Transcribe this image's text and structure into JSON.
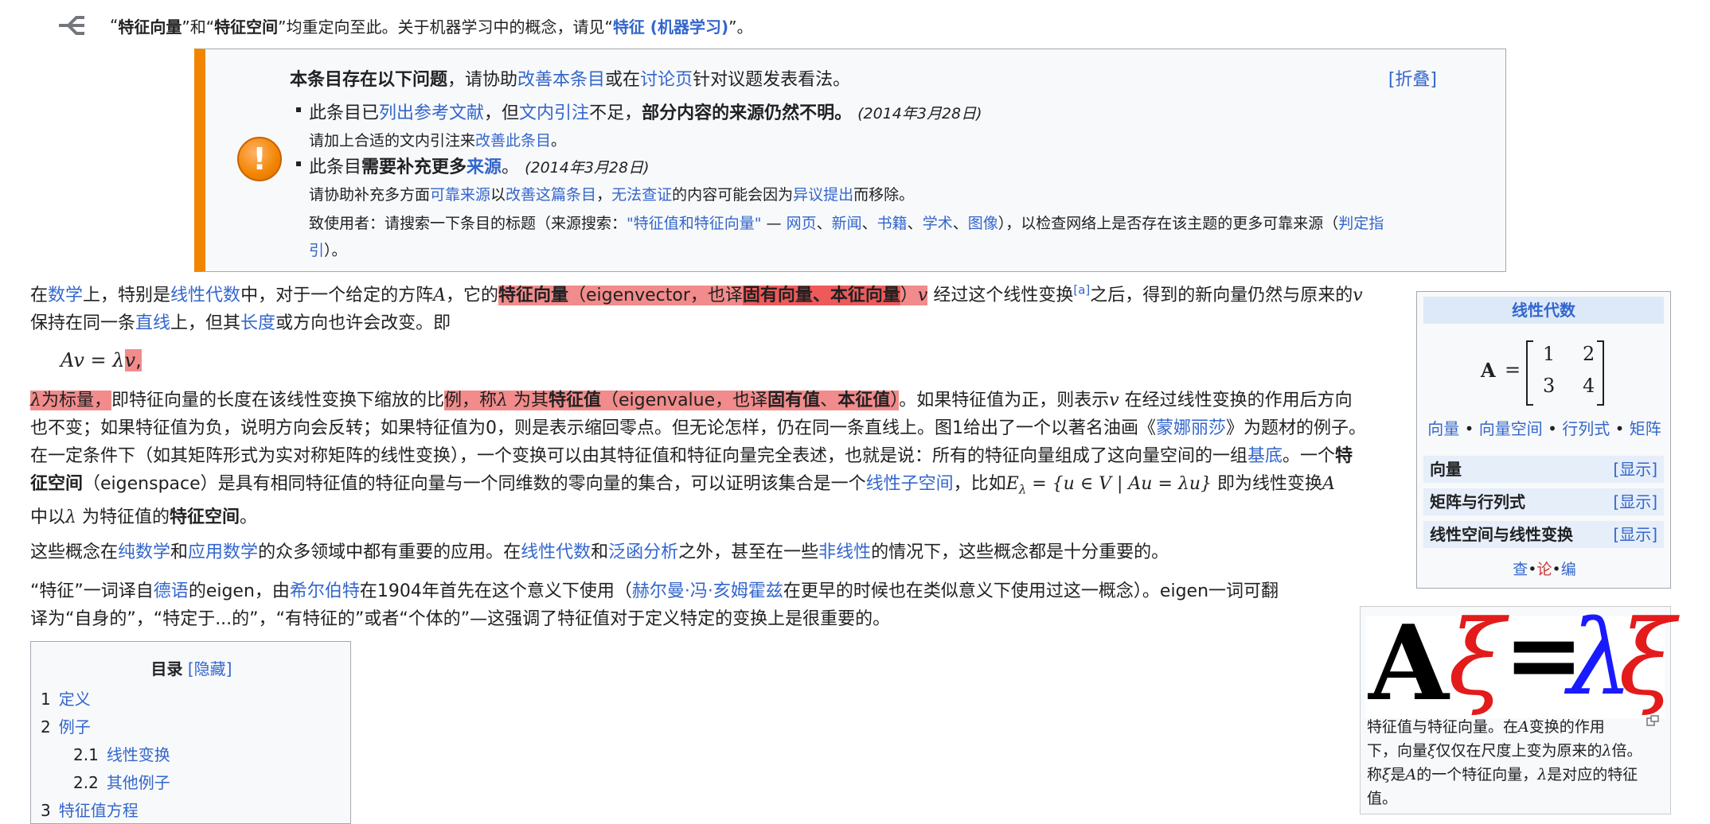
{
  "hatnote": {
    "icon": "disambiguation-icon",
    "q1": "“",
    "term1": "特征向量",
    "q2": "”和“",
    "term2": "特征空间",
    "text": "”均重定向至此。关于机器学习中的概念，请见“",
    "link": "特征 (机器学习)",
    "end": "”。"
  },
  "issues": {
    "title_bold": "本条目存在以下问题",
    "title_mid1": "，请协助",
    "title_link1": "改善本条目",
    "title_mid2": "或在",
    "title_link2": "讨论页",
    "title_end": "针对议题发表看法。",
    "fold": "[折叠]",
    "item1_a": "此条目已",
    "item1_link1": "列出参考文献",
    "item1_b": "，但",
    "item1_link2": "文内引注",
    "item1_c": "不足，",
    "item1_bold": "部分内容的来源仍然不明。",
    "item1_date": "(2014年3月28日)",
    "item1_sub_a": "请加上合适的文内引注来",
    "item1_sub_link": "改善此条目",
    "item1_sub_b": "。",
    "item2_a": "此条目",
    "item2_bold": "需要补充更多",
    "item2_link": "来源",
    "item2_b": "。",
    "item2_date": "(2014年3月28日)",
    "item2_sub1_a": "请协助补充多方面",
    "item2_sub1_link1": "可靠来源",
    "item2_sub1_b": "以",
    "item2_sub1_link2": "改善这篇条目",
    "item2_sub1_c": "，",
    "item2_sub1_link3": "无法查证",
    "item2_sub1_d": "的内容可能会因为",
    "item2_sub1_link4": "异议提出",
    "item2_sub1_e": "而移除。",
    "item2_sub2_a": "致使用者：请搜索一下条目的标题（来源搜索：",
    "item2_sub2_link1": "\"特征值和特征向量\"",
    "item2_sub2_b": " — ",
    "item2_sub2_link2": "网页",
    "item2_sub2_s1": "、",
    "item2_sub2_link3": "新闻",
    "item2_sub2_s2": "、",
    "item2_sub2_link4": "书籍",
    "item2_sub2_s3": "、",
    "item2_sub2_link5": "学术",
    "item2_sub2_s4": "、",
    "item2_sub2_link6": "图像",
    "item2_sub2_c": "），以检查网络上是否存在该主题的更多可靠来源（",
    "item2_sub2_link7a": "判定指",
    "item2_sub2_link7b": "引",
    "item2_sub2_d": "）。"
  },
  "para1": {
    "t1": "在",
    "l1": "数学",
    "t2": "上，特别是",
    "l2": "线性代数",
    "t3": "中，对于一个给定的方阵",
    "m1": "A",
    "t4": "，它的",
    "b1": "特征向量",
    "t5": "（eigenvector，也译",
    "b2": "固有向量、本征向量",
    "t6": "）",
    "m2": "v",
    "t7": " 经过这个线性变换",
    "ref": "[a]",
    "t8": "之后，得到的新向量仍然与原来的",
    "m3": "v",
    "l2a": "保持在同一条",
    "l3": "直线",
    "t9": "上，但其",
    "l4": "长度",
    "t10": "或方向也许会改变。即"
  },
  "eq1": {
    "lhs": "Av",
    "eq": " = ",
    "lam": "λ",
    "v": "v",
    "comma": ","
  },
  "para2": {
    "lam": "λ",
    "t1": "为标量，",
    "t2": "即特征向量的长度在该线性变换下缩放的比",
    "t3": "例，称",
    "lam2": "λ",
    "t4": " 为其",
    "b1": "特征值",
    "t5": "（eigenvalue，也译",
    "b2": "固有值",
    "t6": "、",
    "b3": "本征值",
    "t7": "）",
    "t8": "。如果特征值为正，则表示",
    "mv": "v",
    "t9": " 在经过线性变换的作用后方向",
    "line2": "也不变；如果特征值为负，说明方向会反转；如果特征值为0，则是表示缩回零点。但无论怎样，仍在同一条直线上。图1给出了一个以著名油画《",
    "l1": "蒙娜丽莎",
    "line2b": "》为题材的例子。",
    "line3": "在一定条件下（如其矩阵形式为实对称矩阵的线性变换），一个变换可以由其特征值和特征向量完全表述，也就是说：所有的特征向量组成了这向量空间的一组",
    "l2": "基底",
    "line3b": "。一个",
    "b4": "特",
    "b5": "征空间",
    "line4": "（eigenspace）是具有相同特征值的特征向量与一个同维数的零向量的集合，可以证明该集合是一个",
    "l3": "线性子空间",
    "line4b": "，比如",
    "eq": "E",
    "eqsub": "λ",
    "eqrest": " = {u ∈ V | Au = λu}",
    "line4c": " 即为线性变换",
    "mA": "A",
    "line5": "中以",
    "lam3": "λ",
    "line5b": " 为特征值的",
    "b6": "特征空间",
    "line5c": "。"
  },
  "para3": {
    "t1": "这些概念在",
    "l1": "纯数学",
    "t2": "和",
    "l2": "应用数学",
    "t3": "的众多领域中都有重要的应用。在",
    "l3": "线性代数",
    "t4": "和",
    "l4": "泛函分析",
    "t5": "之外，甚至在一些",
    "l5": "非线性",
    "t6": "的情况下，这些概念都是十分重要的。"
  },
  "para4": {
    "t1": "“特征”一词译自",
    "l1": "德语",
    "t2": "的eigen，由",
    "l2": "希尔伯特",
    "t3": "在1904年首先在这个意义下使用（",
    "l3": "赫尔曼·冯·亥姆霍兹",
    "t4": "在更早的时候也在类似意义下使用过这一概念）。eigen一词可翻",
    "line2": "译为“自身的”，“特定于...的”，“有特征的”或者“个体的”—这强调了特征值对于定义特定的变换上是很重要的。"
  },
  "navbox": {
    "title": "线性代数",
    "matrix_label": "A",
    "matrix": [
      [
        "1",
        "2"
      ],
      [
        "3",
        "4"
      ]
    ],
    "links": [
      "向量",
      "向量空间",
      "行列式",
      "矩阵"
    ],
    "sep": "•",
    "rows": [
      {
        "label": "向量",
        "show": "[显示]"
      },
      {
        "label": "矩阵与行列式",
        "show": "[显示]"
      },
      {
        "label": "线性空间与线性变换",
        "show": "[显示]"
      }
    ],
    "vte": [
      "查",
      "论",
      "编"
    ]
  },
  "figure": {
    "formula": {
      "A": "A",
      "xi1": "ξ",
      "eq": "=",
      "lam": "λ",
      "xi2": "ξ"
    },
    "cap1": "特征值与特征向量。在",
    "capA": "A",
    "cap2": "变换的作用",
    "cap3": "下，向量",
    "capxi": "ξ",
    "cap4": "仅仅在尺度上变为原来的",
    "caplam": "λ",
    "cap5": "倍。",
    "cap6": "称",
    "capxi2": "ξ",
    "cap7": "是",
    "capA2": "A",
    "cap8": "的一个特征向量，",
    "caplam2": "λ",
    "cap9": "是对应的特征",
    "cap10": "值。"
  },
  "toc": {
    "title": "目录",
    "hide": "[隐藏]",
    "items": [
      {
        "num": "1",
        "label": "定义"
      },
      {
        "num": "2",
        "label": "例子"
      },
      {
        "num": "2.1",
        "label": "线性变换"
      },
      {
        "num": "2.2",
        "label": "其他例子"
      },
      {
        "num": "3",
        "label": "特征值方程"
      }
    ]
  },
  "colors": {
    "link": "#3366cc",
    "highlight": "#f28b8b",
    "warning": "#f28500",
    "formula_red": "#e31b1b",
    "formula_blue": "#1a1aff"
  }
}
